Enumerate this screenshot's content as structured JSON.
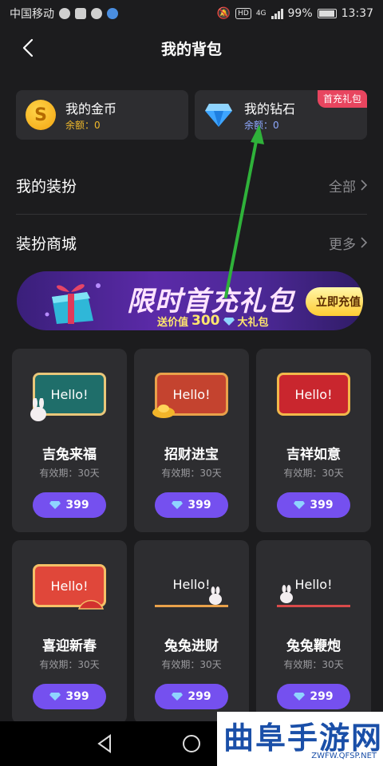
{
  "status_bar": {
    "carrier": "中国移动",
    "network": "4G",
    "hd": "HD",
    "battery": "99%",
    "time": "13:37"
  },
  "header": {
    "title": "我的背包"
  },
  "wallet": {
    "coins": {
      "label": "我的金币",
      "balance_label": "余额：",
      "balance": "0",
      "icon": "coin-icon",
      "icon_text": "S"
    },
    "diamonds": {
      "label": "我的钻石",
      "balance_label": "余额：",
      "balance": "0",
      "icon": "diamond-icon",
      "badge": "首充礼包"
    }
  },
  "rows": {
    "outfits": {
      "label": "我的装扮",
      "link": "全部"
    },
    "mall": {
      "label": "装扮商城",
      "link": "更多"
    }
  },
  "banner": {
    "title": "限时首充礼包",
    "sub_prefix": "送价值",
    "sub_amount": "300",
    "sub_suffix": "大礼包",
    "button": "立即充值"
  },
  "items": [
    {
      "name": "吉兔来福",
      "validity": "有效期：30天",
      "price": "399",
      "art_text": "Hello!",
      "color": "#1f6e6a"
    },
    {
      "name": "招财进宝",
      "validity": "有效期：30天",
      "price": "399",
      "art_text": "Hello!",
      "color": "#c4432f"
    },
    {
      "name": "吉祥如意",
      "validity": "有效期：30天",
      "price": "399",
      "art_text": "Hello!",
      "color": "#c9262e"
    },
    {
      "name": "喜迎新春",
      "validity": "有效期：30天",
      "price": "399",
      "art_text": "Hello!",
      "color": "#e0473a"
    },
    {
      "name": "兔兔进财",
      "validity": "有效期：30天",
      "price": "299",
      "art_text": "Hello!",
      "color": "#2d2d30"
    },
    {
      "name": "兔兔鞭炮",
      "validity": "有效期：30天",
      "price": "299",
      "art_text": "Hello!",
      "color": "#2d2d30"
    }
  ],
  "watermark": {
    "main": "曲阜手游网",
    "sub": "ZWFW.QFSP.NET"
  },
  "colors": {
    "accent": "#7550ef",
    "badge": "#e8455f",
    "coin": "#f0b92b",
    "annotation": "#2fb23a"
  }
}
